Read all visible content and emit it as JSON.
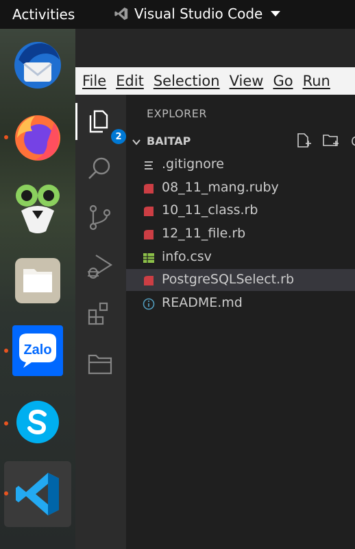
{
  "topbar": {
    "activities": "Activities",
    "app_name": "Visual Studio Code"
  },
  "dock": {
    "items": [
      {
        "name": "thunderbird",
        "running": false
      },
      {
        "name": "firefox",
        "running": true
      },
      {
        "name": "cheese",
        "running": false
      },
      {
        "name": "files",
        "running": false
      },
      {
        "name": "zalo",
        "running": true,
        "label": "Zalo"
      },
      {
        "name": "skype",
        "running": true
      },
      {
        "name": "vscode",
        "running": true
      }
    ]
  },
  "menubar": {
    "items": [
      "File",
      "Edit",
      "Selection",
      "View",
      "Go",
      "Run"
    ]
  },
  "activitybar": {
    "explorer_badge": "2"
  },
  "explorer": {
    "title": "EXPLORER",
    "folder": "BAITAP",
    "files": [
      {
        "name": ".gitignore",
        "icon": "lines-icon"
      },
      {
        "name": "08_11_mang.ruby",
        "icon": "ruby-icon"
      },
      {
        "name": "10_11_class.rb",
        "icon": "ruby-icon"
      },
      {
        "name": "12_11_file.rb",
        "icon": "ruby-icon"
      },
      {
        "name": "info.csv",
        "icon": "table-icon"
      },
      {
        "name": "PostgreSQLSelect.rb",
        "icon": "ruby-icon",
        "selected": true
      },
      {
        "name": "README.md",
        "icon": "info-icon"
      }
    ]
  },
  "colors": {
    "accent": "#0078d4",
    "ruby": "#cc3e44",
    "csv": "#8dc149",
    "info": "#519aba",
    "ubuntu_orange": "#e95420"
  }
}
